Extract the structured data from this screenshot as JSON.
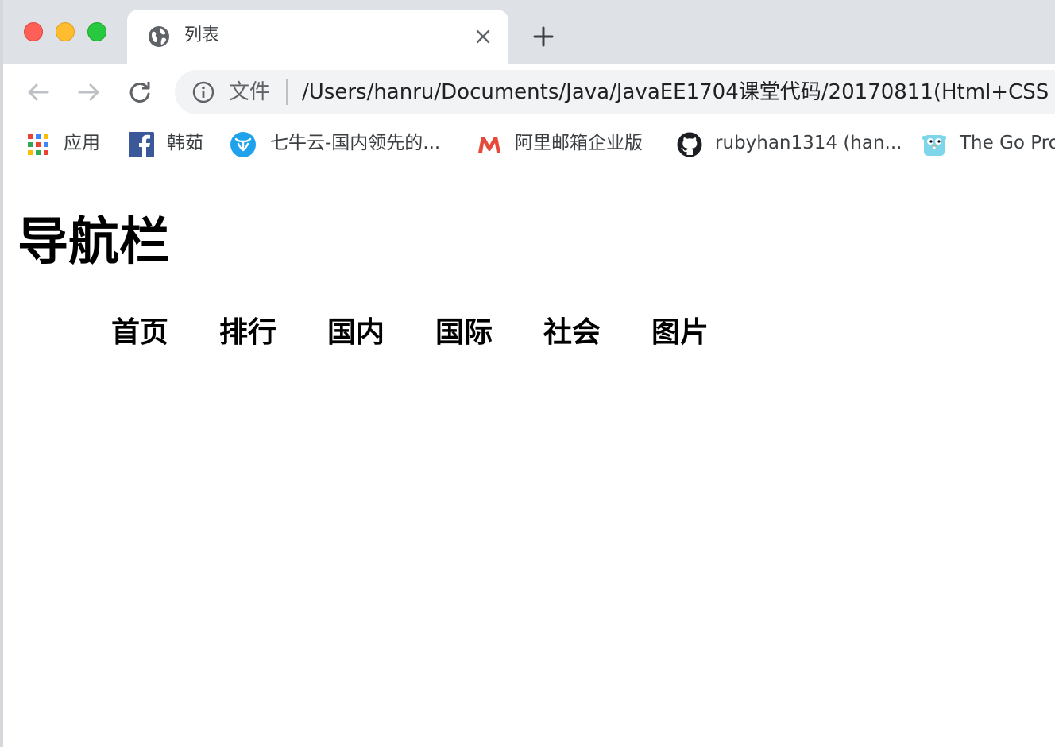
{
  "tab": {
    "title": "列表"
  },
  "omnibox": {
    "security_label": "文件",
    "url": "/Users/hanru/Documents/Java/JavaEE1704课堂代码/20170811(Html+CSS"
  },
  "bookmarks": [
    {
      "label": "应用",
      "icon": "apps-grid-icon"
    },
    {
      "label": "韩茹",
      "icon": "facebook-icon"
    },
    {
      "label": "七牛云-国内领先的...",
      "icon": "qiniu-icon"
    },
    {
      "label": "阿里邮箱企业版",
      "icon": "mail-m-icon"
    },
    {
      "label": "rubyhan1314 (han...",
      "icon": "github-icon"
    },
    {
      "label": "The Go Pro",
      "icon": "gopher-icon"
    }
  ],
  "page": {
    "heading": "导航栏",
    "nav_items": [
      "首页",
      "排行",
      "国内",
      "国际",
      "社会",
      "图片"
    ]
  },
  "colors": {
    "tabstrip_bg": "#dee1e6",
    "omnibox_bg": "#f1f3f4",
    "traffic_close": "#fe5f57",
    "traffic_minimize": "#febc2e",
    "traffic_maximize": "#28c840"
  }
}
